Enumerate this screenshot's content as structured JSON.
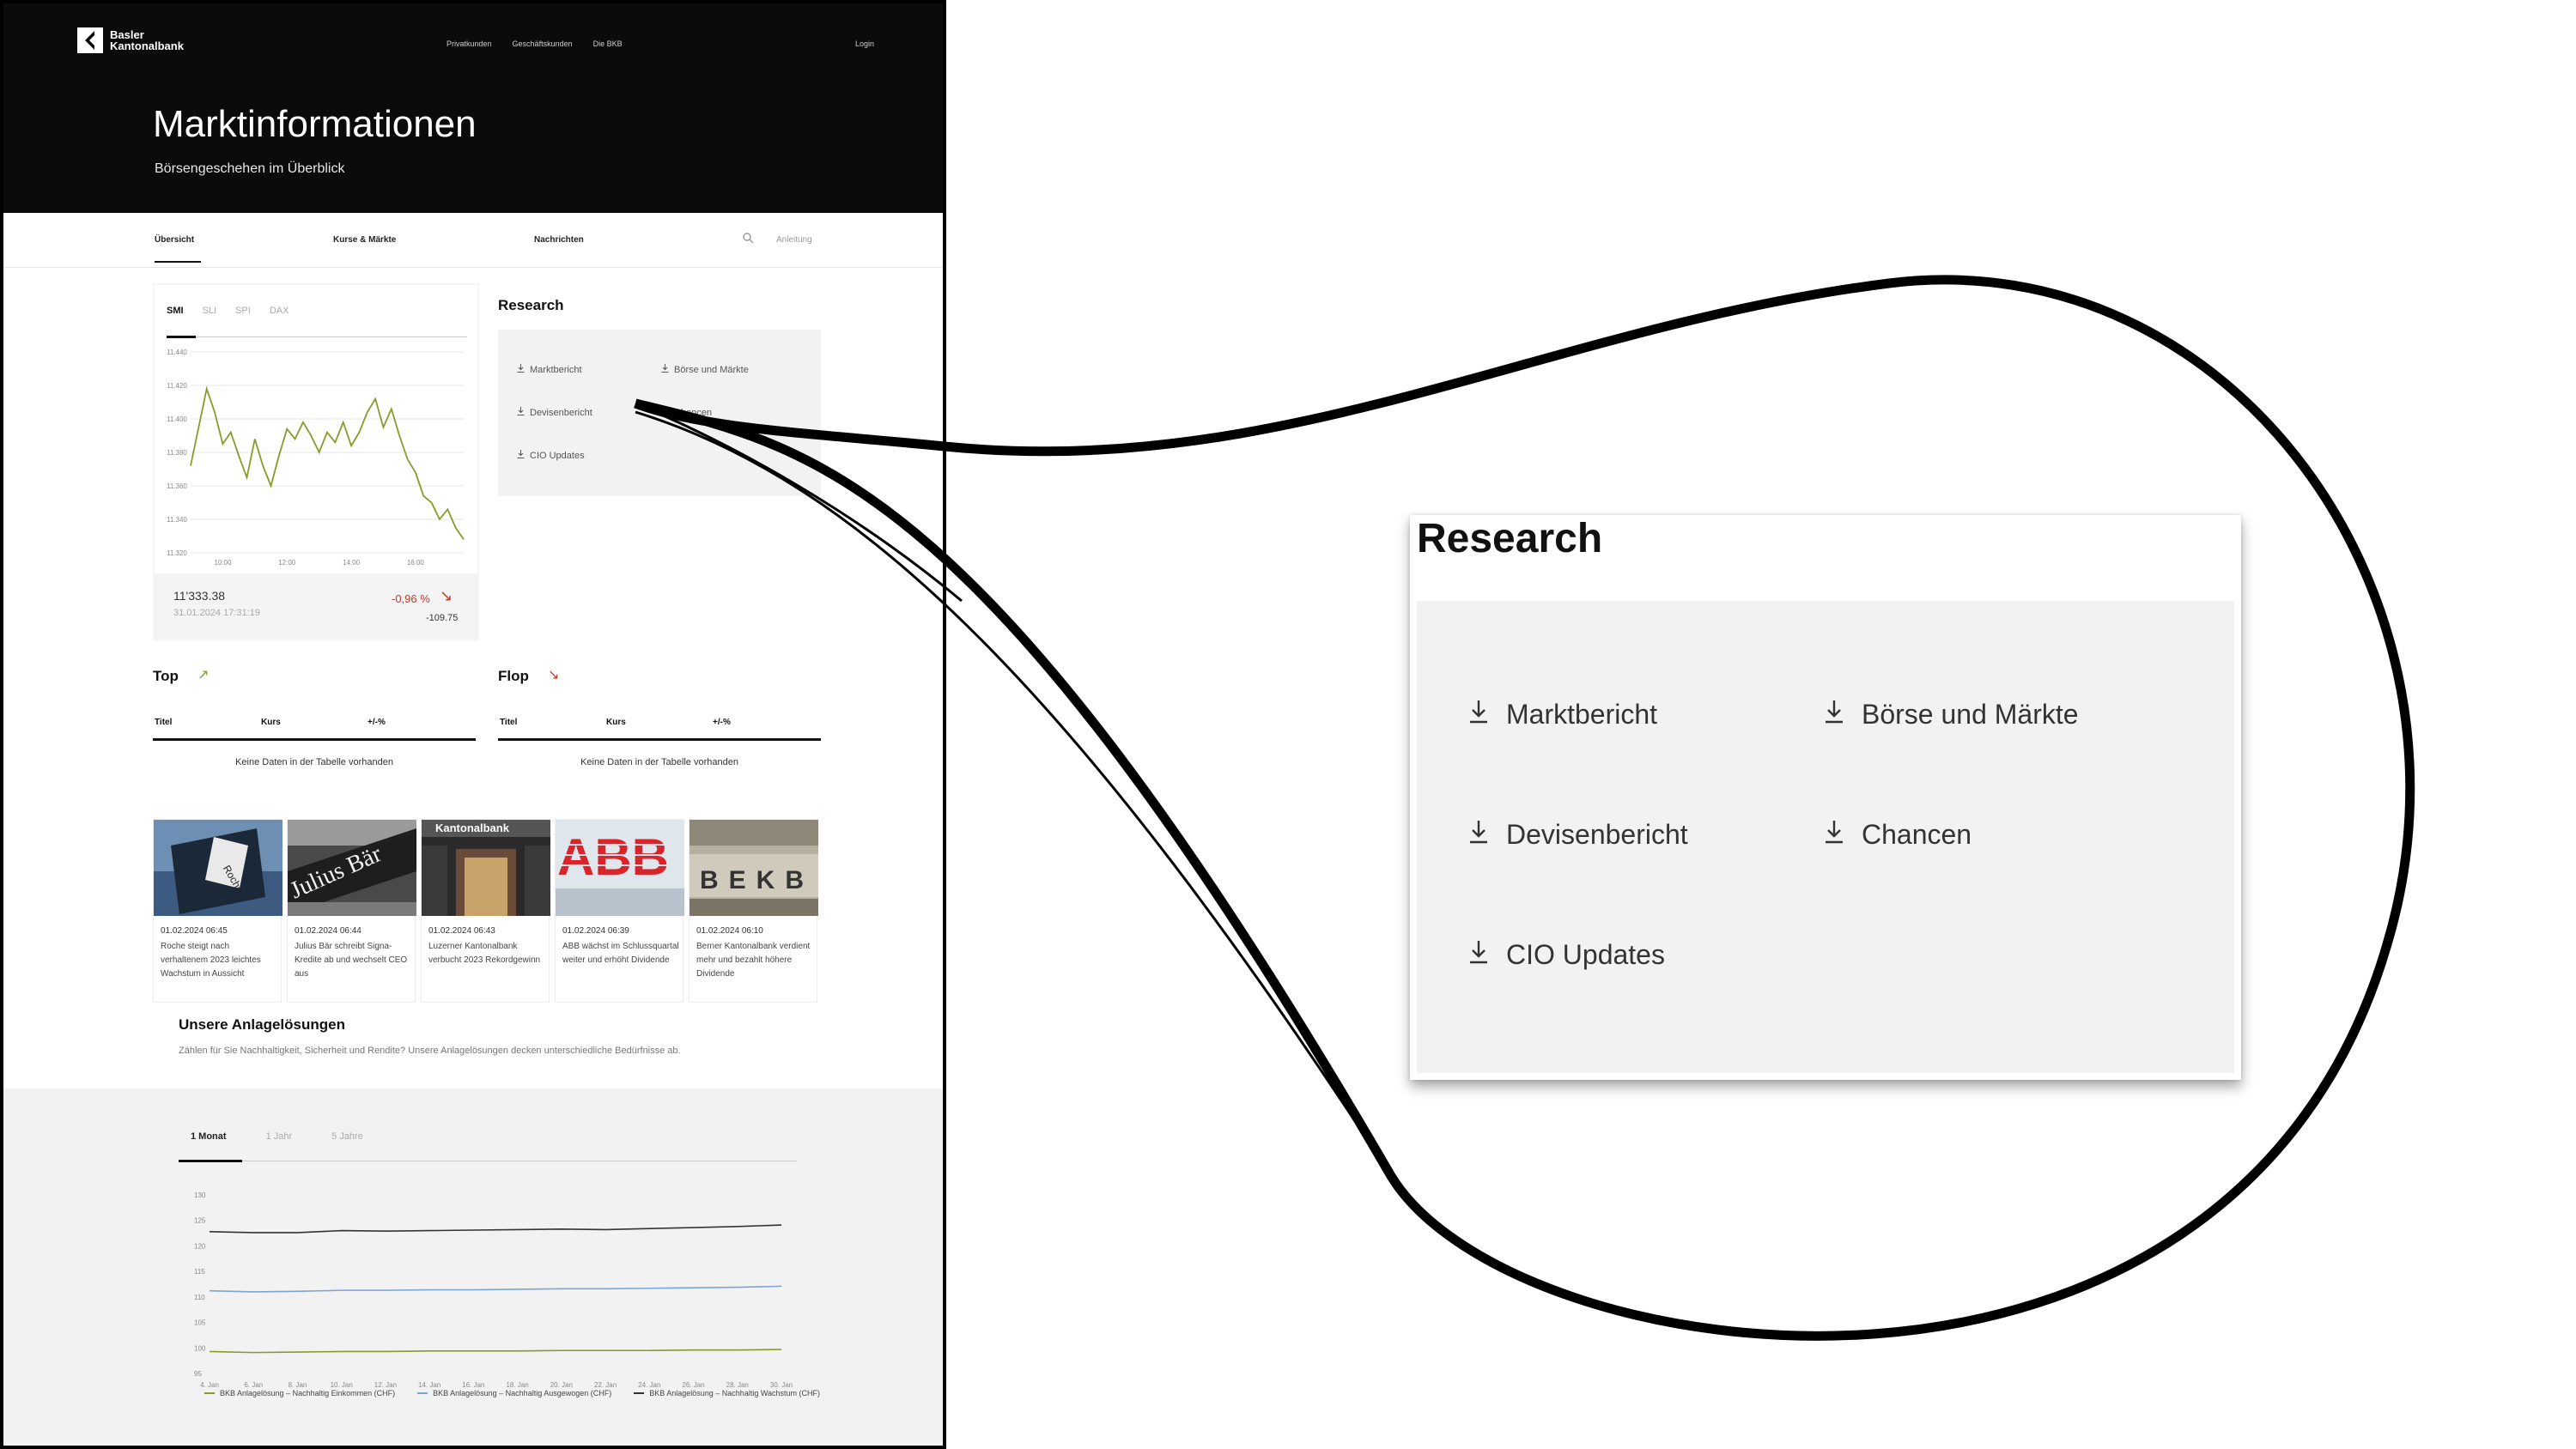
{
  "brand": {
    "name_line1": "Basler",
    "name_line2": "Kantonalbank"
  },
  "topnav": [
    "Privatkunden",
    "Geschäftskunden",
    "Die BKB"
  ],
  "login_label": "Login",
  "hero": {
    "title": "Marktinformationen",
    "subtitle": "Börsengeschehen im Überblick"
  },
  "subnav": {
    "items": [
      "Übersicht",
      "Kurse & Märkte",
      "Nachrichten"
    ],
    "active": "Übersicht",
    "secondary": "Anleitung"
  },
  "index_widget": {
    "tabs": [
      "SMI",
      "SLI",
      "SPI",
      "DAX"
    ],
    "active_tab": "SMI",
    "price": "11'333.38",
    "datetime": "31.01.2024 17:31:19",
    "change_pct": "-0,96 %",
    "change_abs": "-109.75",
    "trend_icon": "arrow-down-right",
    "negative_color": "#c0392b",
    "line_color": "#8a9a2a"
  },
  "research": {
    "title": "Research",
    "items": [
      "Marktbericht",
      "Börse und Märkte",
      "Devisenbericht",
      "Chancen",
      "CIO Updates"
    ],
    "icon": "download-icon"
  },
  "top": {
    "title": "Top",
    "columns": [
      "Titel",
      "Kurs",
      "+/-%"
    ],
    "empty": "Keine Daten in der Tabelle vorhanden",
    "arrow_color": "#7aa33a"
  },
  "flop": {
    "title": "Flop",
    "columns": [
      "Titel",
      "Kurs",
      "+/-%"
    ],
    "empty": "Keine Daten in der Tabelle vorhanden",
    "arrow_color": "#c0392b"
  },
  "news": [
    {
      "date": "01.02.2024 06:45",
      "text": "Roche steigt nach verhaltenem 2023 leichtes Wachstum in Aussicht",
      "image": "roche-building-photo"
    },
    {
      "date": "01.02.2024 06:44",
      "text": "Julius Bär schreibt Signa-Kredite ab und wechselt CEO aus",
      "image": "julius-baer-sign-photo"
    },
    {
      "date": "01.02.2024 06:43",
      "text": "Luzerner Kantonalbank verbucht 2023 Rekordgewinn",
      "image": "kantonalbank-entrance-photo"
    },
    {
      "date": "01.02.2024 06:39",
      "text": "ABB wächst im Schlussquartal weiter und erhöht Dividende",
      "image": "abb-logo-photo"
    },
    {
      "date": "01.02.2024 06:10",
      "text": "Berner Kantonalbank verdient mehr und bezahlt höhere Dividende",
      "image": "bekb-facade-photo"
    }
  ],
  "anlage": {
    "title": "Unsere Anlagelösungen",
    "subtitle": "Zählen für Sie Nachhaltigkeit, Sicherheit und Rendite? Unsere Anlagelösungen decken unterschiedliche Bedürfnisse ab."
  },
  "performance": {
    "tabs": [
      "1 Monat",
      "1 Jahr",
      "5 Jahre"
    ],
    "active_tab": "1 Monat",
    "legend": [
      {
        "name": "BKB Anlagelösung – Nachhaltig Einkommen (CHF)",
        "color": "#8a9a2a"
      },
      {
        "name": "BKB Anlagelösung – Nachhaltig Ausgewogen (CHF)",
        "color": "#7aa6d6"
      },
      {
        "name": "BKB Anlagelösung – Nachhaltig Wachstum (CHF)",
        "color": "#333333"
      }
    ]
  },
  "chart_data": [
    {
      "type": "line",
      "title": "",
      "xlabel": "",
      "ylabel": "",
      "x_ticks": [
        "10:00",
        "12:00",
        "14:00",
        "16:00"
      ],
      "y_ticks": [
        "11.320",
        "11.340",
        "11.360",
        "11.380",
        "11.400",
        "11.420",
        "11.440"
      ],
      "ylim": [
        11320,
        11440
      ],
      "x_range": [
        "09:00",
        "17:30"
      ],
      "grid": true,
      "series": [
        {
          "color": "#8a9a2a",
          "x": [
            "09:00",
            "09:15",
            "09:30",
            "09:45",
            "10:00",
            "10:15",
            "10:30",
            "10:45",
            "11:00",
            "11:15",
            "11:30",
            "11:45",
            "12:00",
            "12:15",
            "12:30",
            "12:45",
            "13:00",
            "13:15",
            "13:30",
            "13:45",
            "14:00",
            "14:15",
            "14:30",
            "14:45",
            "15:00",
            "15:15",
            "15:30",
            "15:45",
            "16:00",
            "16:15",
            "16:30",
            "16:45",
            "17:00",
            "17:15",
            "17:30"
          ],
          "values": [
            11372,
            11395,
            11418,
            11404,
            11385,
            11392,
            11378,
            11365,
            11388,
            11372,
            11360,
            11378,
            11394,
            11388,
            11398,
            11390,
            11380,
            11392,
            11386,
            11398,
            11384,
            11392,
            11404,
            11412,
            11395,
            11406,
            11390,
            11376,
            11368,
            11354,
            11350,
            11340,
            11346,
            11335,
            11328
          ]
        }
      ]
    },
    {
      "type": "line",
      "title": "",
      "xlabel": "",
      "ylabel": "",
      "x_ticks": [
        "4. Jan",
        "6. Jan",
        "8. Jan",
        "10. Jan",
        "12. Jan",
        "14. Jan",
        "16. Jan",
        "18. Jan",
        "20. Jan",
        "22. Jan",
        "24. Jan",
        "26. Jan",
        "28. Jan",
        "30. Jan"
      ],
      "y_ticks": [
        "95",
        "100",
        "105",
        "110",
        "115",
        "120",
        "125",
        "130"
      ],
      "ylim": [
        95,
        130
      ],
      "legend": "bottom",
      "series": [
        {
          "name": "BKB Anlagelösung – Nachhaltig Einkommen (CHF)",
          "color": "#8a9a2a",
          "x": [
            "4. Jan",
            "6. Jan",
            "8. Jan",
            "10. Jan",
            "12. Jan",
            "14. Jan",
            "16. Jan",
            "18. Jan",
            "20. Jan",
            "22. Jan",
            "24. Jan",
            "26. Jan",
            "28. Jan",
            "30. Jan"
          ],
          "values": [
            99.3,
            99.1,
            99.2,
            99.3,
            99.3,
            99.4,
            99.4,
            99.4,
            99.5,
            99.5,
            99.5,
            99.6,
            99.6,
            99.7
          ]
        },
        {
          "name": "BKB Anlagelösung – Nachhaltig Ausgewogen (CHF)",
          "color": "#7aa6d6",
          "x": [
            "4. Jan",
            "6. Jan",
            "8. Jan",
            "10. Jan",
            "12. Jan",
            "14. Jan",
            "16. Jan",
            "18. Jan",
            "20. Jan",
            "22. Jan",
            "24. Jan",
            "26. Jan",
            "28. Jan",
            "30. Jan"
          ],
          "values": [
            111.2,
            111.0,
            111.1,
            111.3,
            111.3,
            111.4,
            111.4,
            111.5,
            111.6,
            111.6,
            111.7,
            111.8,
            111.9,
            112.1
          ]
        },
        {
          "name": "BKB Anlagelösung – Nachhaltig Wachstum (CHF)",
          "color": "#333333",
          "x": [
            "4. Jan",
            "6. Jan",
            "8. Jan",
            "10. Jan",
            "12. Jan",
            "14. Jan",
            "16. Jan",
            "18. Jan",
            "20. Jan",
            "22. Jan",
            "24. Jan",
            "26. Jan",
            "28. Jan",
            "30. Jan"
          ],
          "values": [
            122.8,
            122.6,
            122.6,
            123.0,
            122.9,
            123.0,
            123.1,
            123.2,
            123.3,
            123.2,
            123.4,
            123.6,
            123.8,
            124.1
          ]
        }
      ]
    }
  ]
}
